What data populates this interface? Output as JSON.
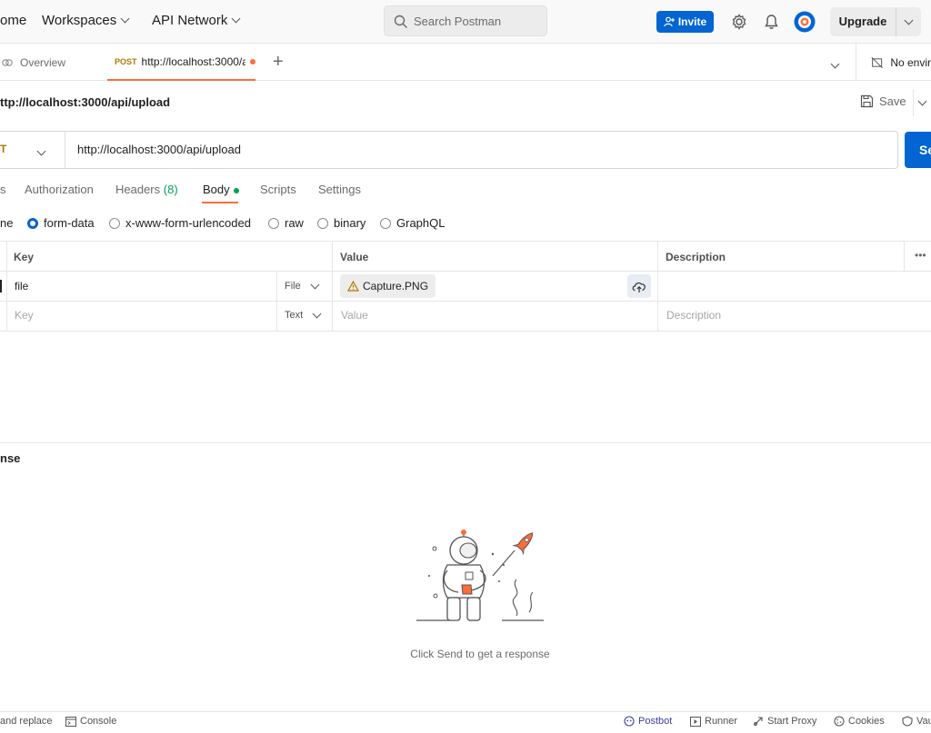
{
  "topnav": {
    "home": "ome",
    "workspaces": "Workspaces",
    "api_network": "API Network",
    "search_placeholder": "Search Postman",
    "invite": "Invite",
    "upgrade": "Upgrade"
  },
  "tabs": {
    "overview": "Overview",
    "active_method": "POST",
    "active_url": "http://localhost:3000/a",
    "environment": "No envir"
  },
  "request": {
    "title": "ttp://localhost:3000/api/upload",
    "save": "Save",
    "method": "T",
    "url": "http://localhost:3000/api/upload",
    "send": "Se"
  },
  "request_tabs": {
    "params": "s",
    "authorization": "Authorization",
    "headers": "Headers",
    "headers_count": "(8)",
    "body": "Body",
    "scripts": "Scripts",
    "settings": "Settings"
  },
  "body_types": {
    "none": "ne",
    "form_data": "form-data",
    "urlencoded": "x-www-form-urlencoded",
    "raw": "raw",
    "binary": "binary",
    "graphql": "GraphQL"
  },
  "table": {
    "headers": {
      "key": "Key",
      "value": "Value",
      "description": "Description"
    },
    "rows": [
      {
        "key": "file",
        "type": "File",
        "value": "Capture.PNG",
        "description": ""
      }
    ],
    "empty_row": {
      "key": "Key",
      "type": "Text",
      "value": "Value",
      "description": "Description"
    }
  },
  "response": {
    "title": "nse",
    "empty_message": "Click Send to get a response"
  },
  "statusbar": {
    "find_replace": "and replace",
    "console": "Console",
    "postbot": "Postbot",
    "runner": "Runner",
    "start_proxy": "Start Proxy",
    "cookies": "Cookies",
    "vault": "Vau"
  },
  "colors": {
    "accent_orange": "#ff6c37",
    "primary_blue": "#0265d2",
    "method_post": "#ad7a03",
    "status_green": "#00a352"
  }
}
